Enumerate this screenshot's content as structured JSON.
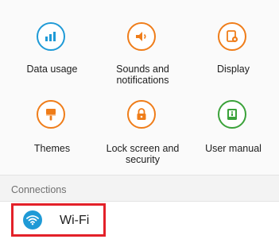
{
  "settings_grid": {
    "items": [
      {
        "label": "Data usage",
        "icon": "data-usage-icon"
      },
      {
        "label": "Sounds and\nnotifications",
        "icon": "sound-icon"
      },
      {
        "label": "Display",
        "icon": "display-icon"
      },
      {
        "label": "Themes",
        "icon": "paintbrush-icon"
      },
      {
        "label": "Lock screen and\nsecurity",
        "icon": "lock-icon"
      },
      {
        "label": "User manual",
        "icon": "user-manual-icon"
      }
    ]
  },
  "connections": {
    "title": "Connections",
    "items": [
      {
        "label": "Wi-Fi",
        "icon": "wifi-icon"
      }
    ]
  },
  "colors": {
    "icon_ring": "#ef7d1a",
    "data_usage_ring": "#1f9ad6",
    "user_manual_ring": "#3ba23a",
    "wifi_icon_bg": "#1f9ad6",
    "highlight_border": "#e32129"
  }
}
